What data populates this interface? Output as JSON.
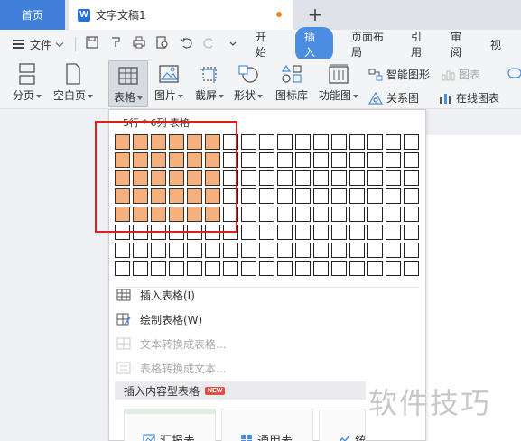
{
  "tabbar": {
    "home_label": "首页",
    "doc_title": "文字文稿1",
    "doc_logo": "W",
    "new_tab": "+"
  },
  "menu": {
    "file_label": "文件",
    "tabs": [
      "开始",
      "插入",
      "页面布局",
      "引用",
      "审阅",
      "视"
    ],
    "active_tab": "插入"
  },
  "ribbon": {
    "page_break": "分页",
    "blank_page": "空白页",
    "table": "表格",
    "picture": "图片",
    "screenshot": "截屏",
    "shapes": "形状",
    "icon_library": "图标库",
    "function_chart": "功能图",
    "smart_art": "智能图形",
    "chart": "图表",
    "relation_map": "关系图",
    "online_chart": "在线图表"
  },
  "dropdown": {
    "grid_label": "5行 * 6列 表格",
    "grid_rows": 8,
    "grid_cols": 17,
    "selected_rows": 5,
    "selected_cols": 6,
    "items": [
      {
        "label": "插入表格(I)",
        "enabled": true,
        "icon": "table-grid-icon"
      },
      {
        "label": "绘制表格(W)",
        "enabled": true,
        "icon": "draw-table-icon"
      },
      {
        "label": "文本转换成表格...",
        "enabled": false,
        "icon": "text-to-table-icon"
      },
      {
        "label": "表格转换成文本...",
        "enabled": false,
        "icon": "table-to-text-icon"
      }
    ],
    "section_title": "插入内容型表格",
    "new_badge": "NEW",
    "cards": [
      "汇报表",
      "通用表",
      "统"
    ]
  },
  "watermark": "软件技巧",
  "colors": {
    "accent": "#4a8de1",
    "home_tab": "#3f7fd9",
    "grid_highlight": "#f6b07e",
    "annotation_red": "#d9201e"
  }
}
